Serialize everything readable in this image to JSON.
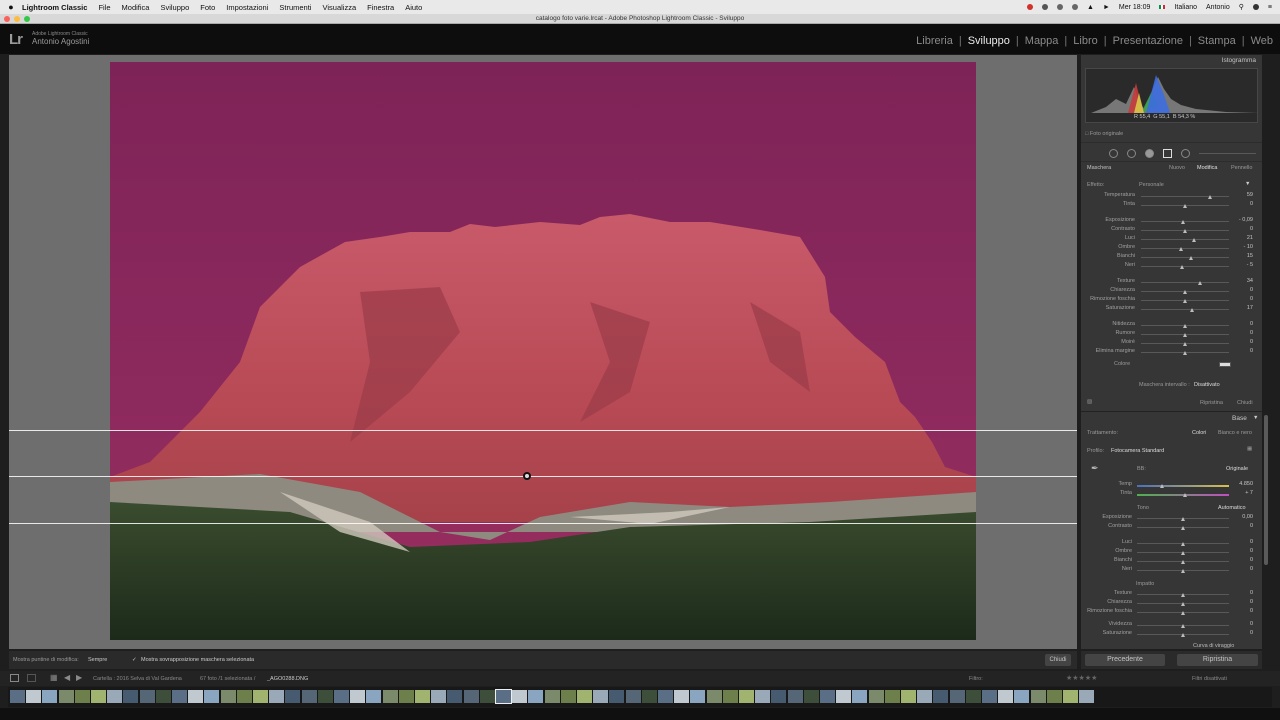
{
  "menubar": {
    "app": "Lightroom Classic",
    "items": [
      "File",
      "Modifica",
      "Sviluppo",
      "Foto",
      "Impostazioni",
      "Strumenti",
      "Visualizza",
      "Finestra",
      "Aiuto"
    ],
    "language": "Italiano",
    "clock": "Mer 18:09",
    "user": "Antonio"
  },
  "window": {
    "title": "catalogo foto varie.lrcat - Adobe Photoshop Lightroom Classic - Sviluppo"
  },
  "identity": {
    "small": "Adobe Lightroom Classic",
    "name": "Antonio Agostini"
  },
  "modules": [
    {
      "label": "Libreria",
      "active": false
    },
    {
      "label": "Sviluppo",
      "active": true
    },
    {
      "label": "Mappa",
      "active": false
    },
    {
      "label": "Libro",
      "active": false
    },
    {
      "label": "Presentazione",
      "active": false
    },
    {
      "label": "Stampa",
      "active": false
    },
    {
      "label": "Web",
      "active": false
    }
  ],
  "histogram": {
    "title": "Istogramma",
    "r_label": "R",
    "r_value": "55,4",
    "g_label": "G",
    "g_value": "55,1",
    "b_label": "B",
    "b_value": "54,3",
    "unit": "%",
    "original_label": "Foto originale"
  },
  "mask": {
    "title": "Maschera",
    "nuovo": "Nuovo",
    "modifica": "Modifica",
    "pennello": "Pennello",
    "effect_label": "Effetto:",
    "effect_value": "Personale",
    "sliders": [
      {
        "label": "Temperatura",
        "value": "59",
        "pos": 0.78
      },
      {
        "label": "Tinta",
        "value": "0",
        "pos": 0.5
      },
      {
        "label": "Esposizione",
        "value": "- 0,09",
        "pos": 0.48
      },
      {
        "label": "Contrasto",
        "value": "0",
        "pos": 0.5
      },
      {
        "label": "Luci",
        "value": "21",
        "pos": 0.6
      },
      {
        "label": "Ombre",
        "value": "- 10",
        "pos": 0.45
      },
      {
        "label": "Bianchi",
        "value": "15",
        "pos": 0.57
      },
      {
        "label": "Neri",
        "value": "- 5",
        "pos": 0.47
      },
      {
        "label": "Texture",
        "value": "34",
        "pos": 0.67
      },
      {
        "label": "Chiarezza",
        "value": "0",
        "pos": 0.5
      },
      {
        "label": "Rimozione foschia",
        "value": "0",
        "pos": 0.5
      },
      {
        "label": "Saturazione",
        "value": "17",
        "pos": 0.58
      },
      {
        "label": "Nitidezza",
        "value": "0",
        "pos": 0.5
      },
      {
        "label": "Rumore",
        "value": "0",
        "pos": 0.5
      },
      {
        "label": "Moiré",
        "value": "0",
        "pos": 0.5
      },
      {
        "label": "Elimina margine",
        "value": "0",
        "pos": 0.5
      }
    ],
    "color_label": "Colore",
    "range_label": "Maschera intervallo :",
    "range_value": "Disattivato",
    "reset": "Ripristina",
    "close": "Chiudi"
  },
  "base": {
    "title": "Base",
    "treatment_label": "Trattamento:",
    "treatment_color": "Colori",
    "treatment_bw": "Bianco e nero",
    "profile_label": "Profilo:",
    "profile_value": "Fotocamera Standard",
    "wb_label": "BB:",
    "wb_value": "Originale",
    "temp_label": "Temp",
    "temp_value": "4.850",
    "temp_pos": 0.27,
    "tint_label": "Tinta",
    "tint_value": "+ 7",
    "tint_pos": 0.52,
    "tone_label": "Tono",
    "auto_label": "Automatico",
    "tone_sliders": [
      {
        "label": "Esposizione",
        "value": "0,00"
      },
      {
        "label": "Contrasto",
        "value": "0"
      },
      {
        "label": "Luci",
        "value": "0"
      },
      {
        "label": "Ombre",
        "value": "0"
      },
      {
        "label": "Bianchi",
        "value": "0"
      },
      {
        "label": "Neri",
        "value": "0"
      }
    ],
    "presence_label": "Impatto",
    "presence_sliders": [
      {
        "label": "Texture",
        "value": "0"
      },
      {
        "label": "Chiarezza",
        "value": "0"
      },
      {
        "label": "Rimozione foschia",
        "value": "0"
      },
      {
        "label": "Vividezza",
        "value": "0"
      },
      {
        "label": "Saturazione",
        "value": "0"
      }
    ],
    "next_panel": "Curva di viraggio"
  },
  "toolbar": {
    "pins_label": "Mostra puntine di modifica:",
    "pins_value": "Sempre",
    "overlay_label": "Mostra sovrapposizione maschera selezionata",
    "done": "Chiudi"
  },
  "nav": {
    "previous": "Precedente",
    "reset": "Ripristina"
  },
  "filmstrip": {
    "source": "Cartella : 2016 Selva di Val Gardena",
    "count": "67 foto /1 selezionata /",
    "filename": "_AGO0288.DNG",
    "filter_label": "Filtro:",
    "filter_value": "Filtri disattivati"
  }
}
